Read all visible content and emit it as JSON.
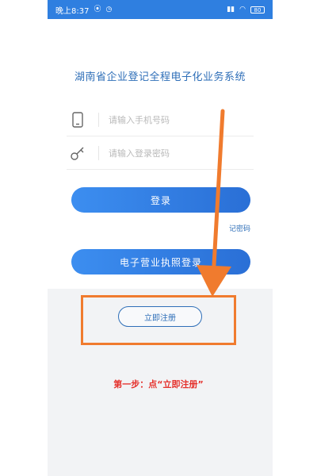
{
  "status_bar": {
    "time": "晚上8:37",
    "left_icons": [
      "vibrate-icon",
      "alarm-icon"
    ],
    "right_icons": [
      "signal-icon",
      "wifi-icon"
    ],
    "battery": "80"
  },
  "app": {
    "title": "湖南省企业登记全程电子化业务系统"
  },
  "login_form": {
    "phone_placeholder": "请输入手机号码",
    "password_placeholder": "请输入登录密码",
    "login_button": "登录",
    "forgot_link": "记密码",
    "license_login_button": "电子营业执照登录",
    "register_button": "立即注册"
  },
  "annotation": {
    "caption": "第一步：点“立即注册”",
    "colors": {
      "arrow": "#f07b2e",
      "caption": "#e5322d"
    }
  },
  "colors": {
    "accent": "#2f7fe0",
    "title": "#2f6fb8"
  }
}
